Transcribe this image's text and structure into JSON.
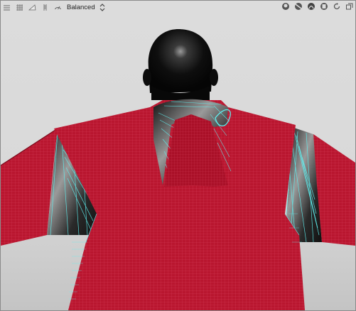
{
  "toolbar": {
    "left_icons": [
      "grid-view-icon",
      "wireframe-grid-icon",
      "plane-icon",
      "ruler-icon",
      "speed-gauge-icon"
    ],
    "render_mode": {
      "label": "Balanced",
      "icon": "up-down-chevron-icon"
    },
    "right_icons": [
      "avatar-view-icon",
      "hide-avatar-icon",
      "texture-icon",
      "garment-view-icon",
      "refresh-camera-icon",
      "restore-window-icon"
    ]
  },
  "scene": {
    "background_color": "#dadada",
    "garment_color": "#b5142d",
    "seam_line_color": "#5ff0f0",
    "avatar_head_color": "#0b0b0b"
  }
}
